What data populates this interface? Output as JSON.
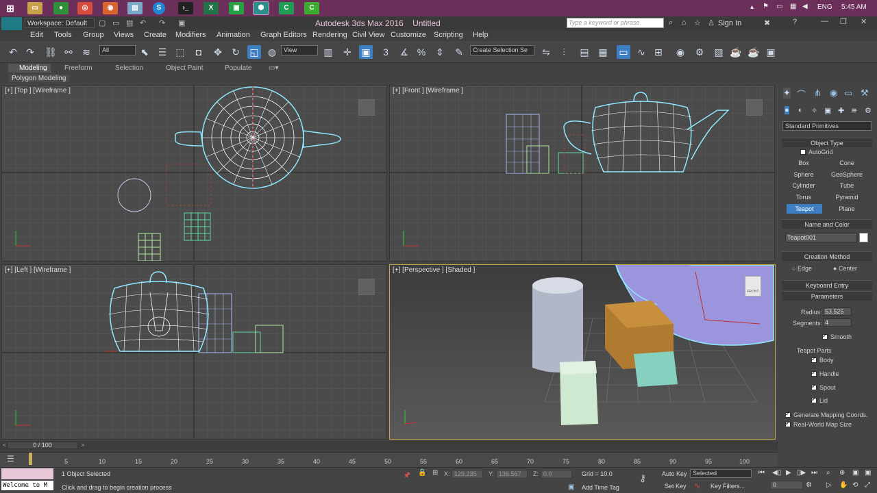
{
  "taskbar": {
    "time": "5:45 AM",
    "lang": "ENG",
    "icons": [
      "windows-icon",
      "explorer-icon",
      "chrome-icon",
      "firefox-icon",
      "remote-icon",
      "skype-icon",
      "cmd-icon",
      "excel-icon",
      "green-app-icon",
      "3dsmax-taskbar-icon",
      "camtasia-icon",
      "camtasia-recorder-icon"
    ]
  },
  "window": {
    "title": "Autodesk 3ds Max 2016",
    "doc_name": "Untitled",
    "workspace": "Workspace: Default",
    "search_placeholder": "Type a keyword or phrase",
    "sign_in": "Sign In",
    "logo": "MAX"
  },
  "menu": [
    "Edit",
    "Tools",
    "Group",
    "Views",
    "Create",
    "Modifiers",
    "Animation",
    "Graph Editors",
    "Rendering",
    "Civil View",
    "Customize",
    "Scripting",
    "Help"
  ],
  "toolbar": {
    "selection_filter": "All",
    "ref_coord": "View",
    "named_selection": "Create Selection Se",
    "snap_label": "3"
  },
  "ribbon": {
    "tabs": [
      "Modeling",
      "Freeform",
      "Selection",
      "Object Paint",
      "Populate"
    ],
    "sub": "Polygon Modeling"
  },
  "viewports": {
    "top": "[+] [Top ] [Wireframe ]",
    "front": "[+] [Front ] [Wireframe ]",
    "left": "[+] [Left ] [Wireframe ]",
    "persp": "[+] [Perspective ] [Shaded ]",
    "cube_front": "FRONT"
  },
  "command_panel": {
    "category": "Standard Primitives",
    "rollouts": {
      "object_type": "Object Type",
      "name_color": "Name and Color",
      "creation_method": "Creation Method",
      "keyboard_entry": "Keyboard Entry",
      "parameters": "Parameters"
    },
    "autogrid": "AutoGrid",
    "buttons": [
      [
        "Box",
        "Cone"
      ],
      [
        "Sphere",
        "GeoSphere"
      ],
      [
        "Cylinder",
        "Tube"
      ],
      [
        "Torus",
        "Pyramid"
      ],
      [
        "Teapot",
        "Plane"
      ]
    ],
    "selected_button": "Teapot",
    "object_name": "Teapot001",
    "creation": {
      "edge": "Edge",
      "center": "Center"
    },
    "params": {
      "radius_label": "Radius:",
      "radius": "53.525",
      "segments_label": "Segments:",
      "segments": "4",
      "smooth": "Smooth",
      "parts_title": "Teapot Parts",
      "body": "Body",
      "handle": "Handle",
      "spout": "Spout",
      "lid": "Lid",
      "gen_mapping": "Generate Mapping Coords.",
      "real_world": "Real-World Map Size"
    }
  },
  "timeline": {
    "frame": "0 / 100",
    "ticks": [
      "5",
      "10",
      "15",
      "20",
      "25",
      "30",
      "35",
      "40",
      "45",
      "50",
      "55",
      "60",
      "65",
      "70",
      "75",
      "80",
      "85",
      "90",
      "95",
      "100"
    ]
  },
  "status": {
    "welcome": "Welcome to M",
    "selected": "1 Object Selected",
    "prompt": "Click and drag to begin creation process",
    "x_label": "X:",
    "x": "129.235",
    "y_label": "Y:",
    "y": "136.567",
    "z_label": "Z:",
    "z": "0.0",
    "grid": "Grid = 10.0",
    "add_time_tag": "Add Time Tag",
    "auto_key": "Auto Key",
    "set_key": "Set Key",
    "key_mode": "Selected",
    "key_filters": "Key Filters...",
    "frame_field": "0"
  }
}
